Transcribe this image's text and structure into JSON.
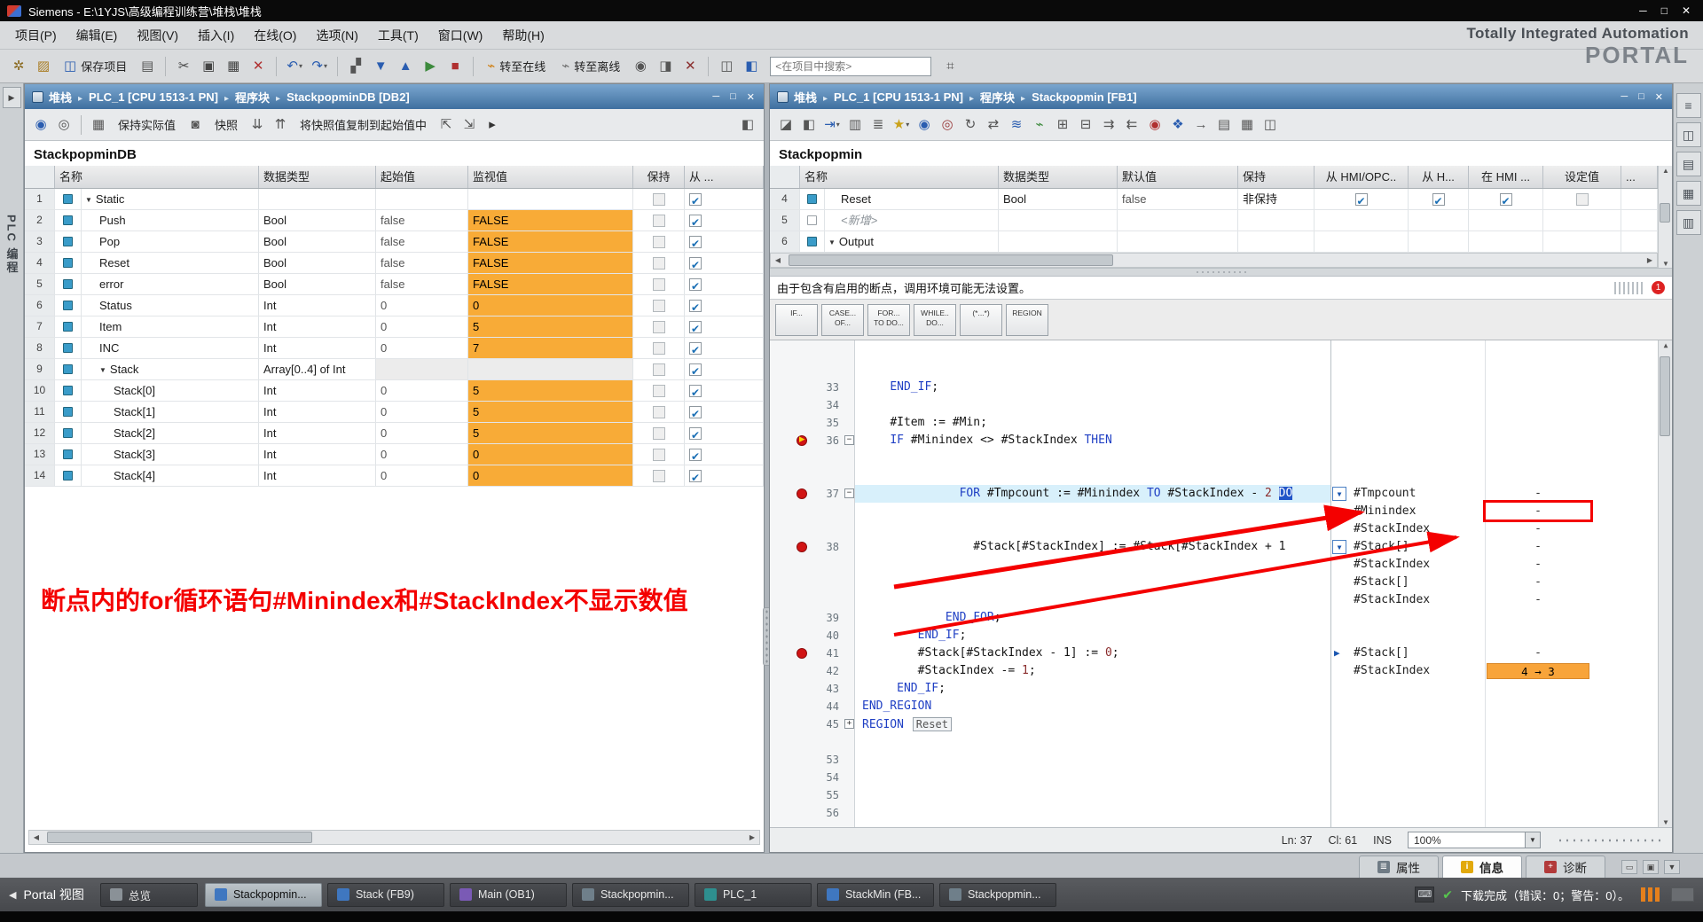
{
  "window": {
    "title": "Siemens  -  E:\\1YJS\\高级编程训练营\\堆栈\\堆栈",
    "min": "─",
    "max": "□",
    "close": "✕"
  },
  "brand": {
    "line1": "Totally Integrated Automation",
    "line2": "PORTAL"
  },
  "menu": [
    "项目(P)",
    "编辑(E)",
    "视图(V)",
    "插入(I)",
    "在线(O)",
    "选项(N)",
    "工具(T)",
    "窗口(W)",
    "帮助(H)"
  ],
  "main_toolbar": {
    "save_label": "保存项目",
    "go_online": "转至在线",
    "go_offline": "转至离线",
    "search_value": "<在项目中搜索>",
    "items": [
      {
        "t": "icon",
        "n": "new-project-icon",
        "g": "✲",
        "c": "#8a6a20"
      },
      {
        "t": "icon",
        "n": "open-project-icon",
        "g": "▨",
        "c": "#a87b20"
      },
      {
        "t": "label",
        "n": "save-project-button",
        "g": "◫",
        "c": "#2a5db0",
        "key": "save_label"
      },
      {
        "t": "icon",
        "n": "print-icon",
        "g": "▤",
        "c": "#555555"
      },
      {
        "t": "sep"
      },
      {
        "t": "icon",
        "n": "cut-icon",
        "g": "✂",
        "c": "#444444"
      },
      {
        "t": "icon",
        "n": "copy-icon",
        "g": "▣",
        "c": "#444444"
      },
      {
        "t": "icon",
        "n": "paste-icon",
        "g": "▦",
        "c": "#444444"
      },
      {
        "t": "icon",
        "n": "delete-icon",
        "g": "✕",
        "c": "#b03030"
      },
      {
        "t": "sep"
      },
      {
        "t": "icon",
        "n": "undo-icon",
        "g": "↶",
        "c": "#2a5db0",
        "dd": true
      },
      {
        "t": "icon",
        "n": "redo-icon",
        "g": "↷",
        "c": "#2a5db0",
        "dd": true
      },
      {
        "t": "sep"
      },
      {
        "t": "icon",
        "n": "compile-icon",
        "g": "▞",
        "c": "#555555"
      },
      {
        "t": "icon",
        "n": "download-to-device-icon",
        "g": "▼",
        "c": "#2a5db0"
      },
      {
        "t": "icon",
        "n": "upload-from-device-icon",
        "g": "▲",
        "c": "#2a5db0"
      },
      {
        "t": "icon",
        "n": "start-cpu-icon",
        "g": "▶",
        "c": "#3c8a3c"
      },
      {
        "t": "icon",
        "n": "stop-cpu-icon",
        "g": "■",
        "c": "#b03030"
      },
      {
        "t": "sep"
      },
      {
        "t": "label",
        "n": "go-online-button",
        "g": "⌁",
        "c": "#cf7f12",
        "key": "go_online"
      },
      {
        "t": "label",
        "n": "go-offline-button",
        "g": "⌁",
        "c": "#6f6f6f",
        "key": "go_offline"
      },
      {
        "t": "icon",
        "n": "online-diagnostics-icon",
        "g": "◉",
        "c": "#555555"
      },
      {
        "t": "icon",
        "n": "simulation-icon",
        "g": "◨",
        "c": "#555555"
      },
      {
        "t": "icon",
        "n": "cross-reference-icon",
        "g": "✕",
        "c": "#8a2f2f"
      },
      {
        "t": "sep"
      },
      {
        "t": "icon",
        "n": "horizontal-split-icon",
        "g": "◫",
        "c": "#555555"
      },
      {
        "t": "icon",
        "n": "vertical-split-icon",
        "g": "◧",
        "c": "#2a5db0"
      },
      {
        "t": "search",
        "n": "project-search-input"
      },
      {
        "t": "icon",
        "n": "accessible-nodes-icon",
        "g": "⌗",
        "c": "#555555"
      }
    ]
  },
  "strips": {
    "left_label": "PLC 编程",
    "left_expander": "▶",
    "right_icons": [
      {
        "g": "≡",
        "n": "sidebar-menu-icon"
      },
      {
        "g": "◫",
        "n": "split-view-icon"
      },
      {
        "g": "▤",
        "n": "testing-panel-icon"
      },
      {
        "g": "▦",
        "n": "tasks-panel-icon"
      },
      {
        "g": "▥",
        "n": "libraries-panel-icon"
      }
    ]
  },
  "crumb_sep": "▸",
  "left_panel": {
    "crumbs": [
      "堆栈",
      "PLC_1 [CPU 1513-1 PN]",
      "程序块",
      "StackpopminDB [DB2]"
    ]
  },
  "right_panel": {
    "crumbs": [
      "堆栈",
      "PLC_1 [CPU 1513-1 PN]",
      "程序块",
      "Stackpopmin [FB1]"
    ]
  },
  "left_toolbar": {
    "keep_actual": "保持实际值",
    "snapshot": "快照",
    "copy_snapshots": "将快照值复制到起始值中",
    "items": [
      {
        "t": "icon",
        "n": "monitor-values-icon",
        "g": "◉",
        "c": "#2a5db0"
      },
      {
        "t": "icon",
        "n": "modify-values-icon",
        "g": "◎",
        "c": "#555555"
      },
      {
        "t": "sep"
      },
      {
        "t": "icon",
        "n": "keep-actual-values-icon",
        "g": "▦",
        "c": "#555555"
      },
      {
        "t": "label",
        "n": "keep-actual-values-button",
        "key": "keep_actual"
      },
      {
        "t": "icon",
        "n": "snapshot-icon",
        "g": "◙",
        "c": "#555555"
      },
      {
        "t": "label",
        "n": "snapshot-button",
        "key": "snapshot"
      },
      {
        "t": "icon",
        "n": "copy-snapshot-down-icon",
        "g": "⇊",
        "c": "#555555"
      },
      {
        "t": "icon",
        "n": "copy-snapshot-up-icon",
        "g": "⇈",
        "c": "#555555"
      },
      {
        "t": "label",
        "n": "copy-snapshots-to-start-button",
        "key": "copy_snapshots"
      },
      {
        "t": "icon",
        "n": "load-start-values-icon",
        "g": "⇱",
        "c": "#555555"
      },
      {
        "t": "icon",
        "n": "reset-start-values-icon",
        "g": "⇲",
        "c": "#555555"
      },
      {
        "t": "icon",
        "n": "more-commands-icon",
        "g": "▸",
        "c": "#333333"
      },
      {
        "t": "spacer"
      },
      {
        "t": "icon",
        "n": "detail-view-icon",
        "g": "◧",
        "c": "#555555"
      }
    ]
  },
  "right_toolbar": {
    "icons": [
      {
        "n": "insert-network-icon",
        "g": "◪",
        "c": "#555555"
      },
      {
        "n": "add-block-icon",
        "g": "◧",
        "c": "#555555"
      },
      {
        "n": "goto-next-icon",
        "g": "⇥",
        "c": "#2a5db0",
        "dd": true
      },
      {
        "n": "absolute-operands-icon",
        "g": "▥",
        "c": "#555555"
      },
      {
        "n": "network-comments-icon",
        "g": "≣",
        "c": "#555555"
      },
      {
        "n": "favorites-icon",
        "g": "★",
        "c": "#caa21a",
        "dd": true
      },
      {
        "n": "monitoring-on-icon",
        "g": "◉",
        "c": "#2a5db0"
      },
      {
        "n": "monitoring-off-icon",
        "g": "◎",
        "c": "#9a3b3b"
      },
      {
        "n": "update-icon",
        "g": "↻",
        "c": "#555555"
      },
      {
        "n": "swap-icon",
        "g": "⇄",
        "c": "#555555"
      },
      {
        "n": "sync-icon",
        "g": "≋",
        "c": "#2a5db0"
      },
      {
        "n": "power-icon",
        "g": "⌁",
        "c": "#3c8a3c"
      },
      {
        "n": "expand-all-icon",
        "g": "⊞",
        "c": "#555555"
      },
      {
        "n": "collapse-all-icon",
        "g": "⊟",
        "c": "#555555"
      },
      {
        "n": "indent-icon",
        "g": "⇉",
        "c": "#555555"
      },
      {
        "n": "outdent-icon",
        "g": "⇇",
        "c": "#555555"
      },
      {
        "n": "breakpoints-icon",
        "g": "◉",
        "c": "#b03030"
      },
      {
        "n": "call-environment-icon",
        "g": "❖",
        "c": "#2a5db0"
      },
      {
        "n": "go-to-icon",
        "g": "→",
        "c": "#555555"
      },
      {
        "n": "block-interface-icon",
        "g": "▤",
        "c": "#555555"
      },
      {
        "n": "snippets-icon",
        "g": "▦",
        "c": "#555555"
      },
      {
        "n": "detail-view-icon",
        "g": "◫",
        "c": "#555555"
      }
    ]
  },
  "left_table": {
    "title": "StackpopminDB",
    "headers": {
      "name": "名称",
      "type": "数据类型",
      "start": "起始值",
      "monitor": "监视值",
      "retain": "保持",
      "from": "从 ..."
    },
    "rows": [
      {
        "n": "1",
        "name": "Static",
        "level": 0,
        "expand": true,
        "kind": "section"
      },
      {
        "n": "2",
        "name": "Push",
        "type": "Bool",
        "start": "false",
        "monitor": "FALSE",
        "level": 1,
        "orange": true
      },
      {
        "n": "3",
        "name": "Pop",
        "type": "Bool",
        "start": "false",
        "monitor": "FALSE",
        "level": 1,
        "orange": true
      },
      {
        "n": "4",
        "name": "Reset",
        "type": "Bool",
        "start": "false",
        "monitor": "FALSE",
        "level": 1,
        "orange": true
      },
      {
        "n": "5",
        "name": "error",
        "type": "Bool",
        "start": "false",
        "monitor": "FALSE",
        "level": 1,
        "orange": true
      },
      {
        "n": "6",
        "name": "Status",
        "type": "Int",
        "start": "0",
        "monitor": "0",
        "level": 1,
        "orange": true
      },
      {
        "n": "7",
        "name": "Item",
        "type": "Int",
        "start": "0",
        "monitor": "5",
        "level": 1,
        "orange": true
      },
      {
        "n": "8",
        "name": "INC",
        "type": "Int",
        "start": "0",
        "monitor": "7",
        "level": 1,
        "orange": true
      },
      {
        "n": "9",
        "name": "Stack",
        "type": "Array[0..4] of Int",
        "level": 1,
        "expand": true,
        "kind": "array"
      },
      {
        "n": "10",
        "name": "Stack[0]",
        "type": "Int",
        "start": "0",
        "monitor": "5",
        "level": 2,
        "orange": true
      },
      {
        "n": "11",
        "name": "Stack[1]",
        "type": "Int",
        "start": "0",
        "monitor": "5",
        "level": 2,
        "orange": true
      },
      {
        "n": "12",
        "name": "Stack[2]",
        "type": "Int",
        "start": "0",
        "monitor": "5",
        "level": 2,
        "orange": true
      },
      {
        "n": "13",
        "name": "Stack[3]",
        "type": "Int",
        "start": "0",
        "monitor": "0",
        "level": 2,
        "orange": true
      },
      {
        "n": "14",
        "name": "Stack[4]",
        "type": "Int",
        "start": "0",
        "monitor": "0",
        "level": 2,
        "orange": true
      }
    ]
  },
  "right_table": {
    "title": "Stackpopmin",
    "headers": {
      "name": "名称",
      "type": "数据类型",
      "default": "默认值",
      "retain": "保持",
      "acc1": "从 HMI/OPC..",
      "acc2": "从 H...",
      "acc3": "在 HMI ...",
      "setp": "设定值",
      "more": "..."
    },
    "rows": [
      {
        "n": "4",
        "name": "Reset",
        "type": "Bool",
        "default": "false",
        "retain": "非保持",
        "cb": [
          true,
          true,
          true,
          false
        ],
        "level": 1
      },
      {
        "n": "5",
        "name": "<新增>",
        "dim": true,
        "level": 1,
        "newrow": true
      },
      {
        "n": "6",
        "name": "Output",
        "kind": "section",
        "expand": true,
        "level": 0
      }
    ]
  },
  "editor": {
    "warning": "由于包含有启用的断点，调用环境可能无法设置。",
    "badge": "1",
    "snippets": [
      {
        "l1": "IF...",
        "l2": ""
      },
      {
        "l1": "CASE...",
        "l2": "OF..."
      },
      {
        "l1": "FOR...",
        "l2": "TO DO..."
      },
      {
        "l1": "WHILE..",
        "l2": "DO..."
      },
      {
        "l1": "(*...*)",
        "l2": ""
      },
      {
        "l1": "REGION",
        "l2": ""
      }
    ],
    "status": {
      "ln": "Ln: 37",
      "cl": "Cl: 61",
      "ins": "INS",
      "zoom": "100%"
    },
    "rows": [
      {
        "ln": "33",
        "t": [
          [
            "    "
          ],
          [
            "END_IF",
            "kw"
          ],
          [
            ";"
          ]
        ]
      },
      {
        "ln": "34"
      },
      {
        "ln": "35",
        "t": [
          [
            "    "
          ],
          [
            "#Item"
          ],
          [
            " := "
          ],
          [
            "#Min"
          ],
          [
            ";"
          ]
        ]
      },
      {
        "ln": "36",
        "bp": true,
        "cur": true,
        "fold": "-",
        "t": [
          [
            "    "
          ],
          [
            "IF",
            "kw"
          ],
          [
            " "
          ],
          [
            "#Minindex"
          ],
          [
            " <> "
          ],
          [
            "#StackIndex"
          ],
          [
            " "
          ],
          [
            "THEN",
            "kw"
          ]
        ]
      },
      {},
      {},
      {
        "ln": "37",
        "bp": true,
        "fold": "-",
        "hl": true,
        "t": [
          [
            "              "
          ],
          [
            "FOR",
            "kw"
          ],
          [
            " "
          ],
          [
            "#Tmpcount"
          ],
          [
            " := "
          ],
          [
            "#Minindex"
          ],
          [
            " "
          ],
          [
            "TO",
            "kw"
          ],
          [
            " "
          ],
          [
            "#StackIndex"
          ],
          [
            " - "
          ],
          [
            "2",
            "n"
          ],
          [
            " "
          ],
          [
            "DO",
            "sel"
          ]
        ],
        "w": {
          "name": "#Tmpcount",
          "val": "-",
          "marker": "combo"
        }
      },
      {
        "w": {
          "name": "#Minindex",
          "val": "-",
          "redbox": true
        }
      },
      {
        "w": {
          "name": "#StackIndex",
          "val": "-"
        }
      },
      {
        "ln": "38",
        "bp": true,
        "t": [
          [
            "                "
          ],
          [
            "#Stack[#StackIndex]"
          ],
          [
            " := "
          ],
          [
            "#Stack[#StackIndex + 1"
          ]
        ],
        "w": {
          "name": "#Stack[]",
          "val": "-",
          "marker": "combo"
        }
      },
      {
        "w": {
          "name": "#StackIndex",
          "val": "-"
        }
      },
      {
        "w": {
          "name": "#Stack[]",
          "val": "-"
        }
      },
      {
        "w": {
          "name": "#StackIndex",
          "val": "-"
        }
      },
      {
        "ln": "39",
        "t": [
          [
            "            "
          ],
          [
            "END_FOR",
            "kw"
          ],
          [
            ";"
          ]
        ]
      },
      {
        "ln": "40",
        "t": [
          [
            "        "
          ],
          [
            "END_IF",
            "kw"
          ],
          [
            ";"
          ]
        ]
      },
      {
        "ln": "41",
        "bp": true,
        "t": [
          [
            "        "
          ],
          [
            "#Stack[#StackIndex - 1]"
          ],
          [
            " := "
          ],
          [
            "0",
            "n"
          ],
          [
            ";"
          ]
        ],
        "w": {
          "name": "#Stack[]",
          "val": "-",
          "marker": "play"
        }
      },
      {
        "ln": "42",
        "t": [
          [
            "        "
          ],
          [
            "#StackIndex"
          ],
          [
            " -= "
          ],
          [
            "1",
            "n"
          ],
          [
            ";"
          ]
        ],
        "w": {
          "name": "#StackIndex",
          "val": "4 → 3",
          "orange": true
        }
      },
      {
        "ln": "43",
        "t": [
          [
            "     "
          ],
          [
            "END_IF",
            "kw"
          ],
          [
            ";"
          ]
        ]
      },
      {
        "ln": "44",
        "t": [
          [
            "END_REGION",
            "kw"
          ]
        ]
      },
      {
        "ln": "45",
        "fold": "+",
        "t": [
          [
            "REGION",
            "kw"
          ],
          [
            " "
          ],
          [
            "Reset",
            "box"
          ]
        ]
      },
      {},
      {
        "ln": "53"
      },
      {
        "ln": "54"
      },
      {
        "ln": "55"
      },
      {
        "ln": "56"
      }
    ]
  },
  "annotation": {
    "text": "断点内的for循环语句#Minindex和#StackIndex不显示数值"
  },
  "info_tabs": [
    {
      "label": "属性",
      "g": "≣",
      "c": "#6f7b85",
      "n": "tab-properties"
    },
    {
      "label": "信息",
      "g": "i",
      "c": "#e2a90c",
      "n": "tab-info",
      "active": true
    },
    {
      "label": "诊断",
      "g": "+",
      "c": "#b23a3a",
      "n": "tab-diagnostics"
    }
  ],
  "taskbar": {
    "portal_arrow": "◀",
    "portal_label": "Portal 视图",
    "overview_label": "总览",
    "buttons": [
      {
        "label": "Stackpopmin...",
        "c": "#3f77c0",
        "active": true
      },
      {
        "label": "Stack (FB9)",
        "c": "#3f77c0"
      },
      {
        "label": "Main (OB1)",
        "c": "#7a5ab5"
      },
      {
        "label": "Stackpopmin...",
        "c": "#6f7f8a"
      },
      {
        "label": "PLC_1",
        "c": "#2e8f8f"
      },
      {
        "label": "StackMin (FB...",
        "c": "#3f77c0"
      },
      {
        "label": "Stackpopmin...",
        "c": "#6f7f8a"
      }
    ],
    "status_text": "下载完成（错误：0；警告：0）。"
  }
}
